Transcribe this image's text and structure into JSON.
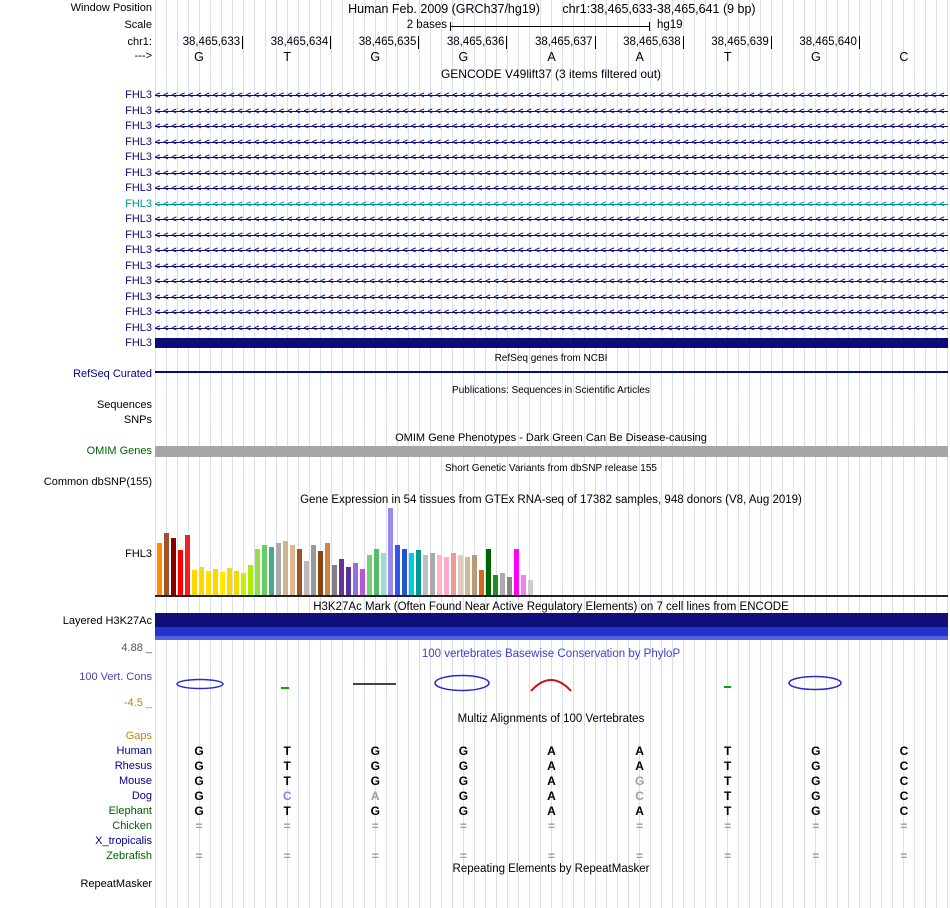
{
  "colors": {
    "grid": "#d3e1f2",
    "gene_blue": "#0c0c78",
    "gene_teal": "#009595",
    "navy": "#00008b",
    "omim_green": "#006400",
    "omim_bar_gray": "#a6a6a6",
    "phylop_title_blue": "#4040d0",
    "gaps_orange": "#c88500",
    "letter_black": "#000000",
    "letter_gray": "#9e9e9e",
    "letter_lightblue": "#8282f0"
  },
  "header": {
    "window_position_label": "Window Position",
    "assembly": "Human Feb. 2009 (GRCh37/hg19)",
    "position": "chr1:38,465,633-38,465,641 (9 bp)",
    "scale_label": "Scale",
    "scale_value": "2 bases",
    "scale_tag": "hg19",
    "chrom_label": "chr1:",
    "strand_label": "--->",
    "coordinates": [
      "38,465,633",
      "38,465,634",
      "38,465,635",
      "38,465,636",
      "38,465,637",
      "38,465,638",
      "38,465,639",
      "38,465,640"
    ],
    "bases": [
      "G",
      "T",
      "G",
      "G",
      "A",
      "A",
      "T",
      "G",
      "C"
    ]
  },
  "gencode": {
    "title": "GENCODE V49lift37 (3 items filtered out)",
    "rows": [
      {
        "label": "FHL3",
        "style": "arrow",
        "color": "blue"
      },
      {
        "label": "FHL3",
        "style": "arrow",
        "color": "blue"
      },
      {
        "label": "FHL3",
        "style": "arrow",
        "color": "blue"
      },
      {
        "label": "FHL3",
        "style": "arrow",
        "color": "blue"
      },
      {
        "label": "FHL3",
        "style": "arrow",
        "color": "blue"
      },
      {
        "label": "FHL3",
        "style": "arrow",
        "color": "blue"
      },
      {
        "label": "FHL3",
        "style": "arrow",
        "color": "blue"
      },
      {
        "label": "FHL3",
        "style": "arrow",
        "color": "teal"
      },
      {
        "label": "FHL3",
        "style": "arrow",
        "color": "blue"
      },
      {
        "label": "FHL3",
        "style": "arrow",
        "color": "blue"
      },
      {
        "label": "FHL3",
        "style": "arrow",
        "color": "blue"
      },
      {
        "label": "FHL3",
        "style": "arrow",
        "color": "blue"
      },
      {
        "label": "FHL3",
        "style": "arrow",
        "color": "blue"
      },
      {
        "label": "FHL3",
        "style": "arrow",
        "color": "blue"
      },
      {
        "label": "FHL3",
        "style": "arrow",
        "color": "blue"
      },
      {
        "label": "FHL3",
        "style": "arrow",
        "color": "blue"
      },
      {
        "label": "FHL3",
        "style": "bar",
        "color": "blue"
      }
    ]
  },
  "refseq": {
    "title": "RefSeq genes from NCBI",
    "label": "RefSeq Curated"
  },
  "publications": {
    "title": "Publications: Sequences in Scientific Articles",
    "sequences_label": "Sequences",
    "snps_label": "SNPs"
  },
  "omim": {
    "title": "OMIM Gene Phenotypes - Dark Green Can Be Disease-causing",
    "label": "OMIM Genes"
  },
  "dbsnp": {
    "title": "Short Genetic Variants from dbSNP release 155",
    "label": "Common dbSNP(155)"
  },
  "gtex": {
    "title": "Gene Expression in 54 tissues from GTEx RNA-seq of 17382 samples, 948 donors (V8, Aug 2019)",
    "label": "FHL3"
  },
  "h3k27ac": {
    "title": "H3K27Ac Mark (Often Found Near Active Regulatory Elements) on 7 cell lines from ENCODE",
    "label": "Layered H3K27Ac"
  },
  "phylop": {
    "title": "100 vertebrates Basewise Conservation by PhyloP",
    "label": "100 Vert. Cons",
    "max_label": "4.88 _",
    "min_label": "-4.5 _"
  },
  "multiz": {
    "title": "Multiz Alignments of 100 Vertebrates",
    "rows": [
      {
        "label": "Gaps",
        "label_color": "#c88500",
        "cells": [
          null,
          null,
          null,
          null,
          null,
          null,
          null,
          null,
          null
        ]
      },
      {
        "label": "Human",
        "label_color": "#00008b",
        "cells": [
          [
            "G",
            "k"
          ],
          [
            "T",
            "k"
          ],
          [
            "G",
            "k"
          ],
          [
            "G",
            "k"
          ],
          [
            "A",
            "k"
          ],
          [
            "A",
            "k"
          ],
          [
            "T",
            "k"
          ],
          [
            "G",
            "k"
          ],
          [
            "C",
            "k"
          ]
        ]
      },
      {
        "label": "Rhesus",
        "label_color": "#00008b",
        "cells": [
          [
            "G",
            "k"
          ],
          [
            "T",
            "k"
          ],
          [
            "G",
            "k"
          ],
          [
            "G",
            "k"
          ],
          [
            "A",
            "k"
          ],
          [
            "A",
            "k"
          ],
          [
            "T",
            "k"
          ],
          [
            "G",
            "k"
          ],
          [
            "C",
            "k"
          ]
        ]
      },
      {
        "label": "Mouse",
        "label_color": "#00008b",
        "cells": [
          [
            "G",
            "k"
          ],
          [
            "T",
            "k"
          ],
          [
            "G",
            "k"
          ],
          [
            "G",
            "k"
          ],
          [
            "A",
            "k"
          ],
          [
            "G",
            "g"
          ],
          [
            "T",
            "k"
          ],
          [
            "G",
            "k"
          ],
          [
            "C",
            "k"
          ]
        ]
      },
      {
        "label": "Dog",
        "label_color": "#00008b",
        "cells": [
          [
            "G",
            "k"
          ],
          [
            "C",
            "b"
          ],
          [
            "A",
            "g"
          ],
          [
            "G",
            "k"
          ],
          [
            "A",
            "k"
          ],
          [
            "C",
            "g"
          ],
          [
            "T",
            "k"
          ],
          [
            "G",
            "k"
          ],
          [
            "C",
            "k"
          ]
        ]
      },
      {
        "label": "Elephant",
        "label_color": "#006400",
        "cells": [
          [
            "G",
            "k"
          ],
          [
            "T",
            "k"
          ],
          [
            "G",
            "k"
          ],
          [
            "G",
            "k"
          ],
          [
            "A",
            "k"
          ],
          [
            "A",
            "k"
          ],
          [
            "T",
            "k"
          ],
          [
            "G",
            "k"
          ],
          [
            "C",
            "k"
          ]
        ]
      },
      {
        "label": "Chicken",
        "label_color": "#006400",
        "cells": [
          [
            "=",
            "g"
          ],
          [
            "=",
            "g"
          ],
          [
            "=",
            "g"
          ],
          [
            "=",
            "g"
          ],
          [
            "=",
            "g"
          ],
          [
            "=",
            "g"
          ],
          [
            "=",
            "g"
          ],
          [
            "=",
            "g"
          ],
          [
            "=",
            "g"
          ]
        ]
      },
      {
        "label": "X_tropicalis",
        "label_color": "#00008b",
        "cells": [
          null,
          null,
          null,
          null,
          null,
          null,
          null,
          null,
          null
        ]
      },
      {
        "label": "Zebrafish",
        "label_color": "#006400",
        "cells": [
          [
            "=",
            "g"
          ],
          [
            "=",
            "g"
          ],
          [
            "=",
            "g"
          ],
          [
            "=",
            "g"
          ],
          [
            "=",
            "g"
          ],
          [
            "=",
            "g"
          ],
          [
            "=",
            "g"
          ],
          [
            "=",
            "g"
          ],
          [
            "=",
            "g"
          ]
        ]
      }
    ]
  },
  "repeatmasker": {
    "title": "Repeating Elements by RepeatMasker",
    "label": "RepeatMasker"
  },
  "chart_data": [
    {
      "type": "bar",
      "title": "Gene Expression in 54 tissues from GTEx RNA-seq of 17382 samples, 948 donors (V8, Aug 2019)",
      "gene": "FHL3",
      "note": "54 GTEx tissue bars; tissue names not visible in screenshot; values are approximate bar heights in pixels",
      "values": [
        52,
        62,
        57,
        45,
        60,
        25,
        28,
        24,
        26,
        23,
        27,
        24,
        22,
        30,
        46,
        50,
        48,
        52,
        54,
        50,
        46,
        34,
        50,
        44,
        52,
        30,
        36,
        28,
        32,
        26,
        40,
        46,
        42,
        87,
        50,
        46,
        42,
        45,
        40,
        42,
        40,
        38,
        42,
        40,
        38,
        40,
        25,
        46,
        20,
        22,
        18,
        46,
        20,
        15
      ],
      "colors": [
        "#ff8c00",
        "#a0522d",
        "#8b0000",
        "#ff0000",
        "#ee2222",
        "#ffd700",
        "#ffd700",
        "#ffe000",
        "#ffd700",
        "#ffea00",
        "#ffd700",
        "#eedd00",
        "#ccee00",
        "#aaee00",
        "#99dd44",
        "#66cc66",
        "#44aa88",
        "#aaaaaa",
        "#d2b48c",
        "#deb887",
        "#a0522d",
        "#bbbbbb",
        "#999999",
        "#8b4513",
        "#cd853f",
        "#808080",
        "#663399",
        "#553399",
        "#9370db",
        "#ba55d3",
        "#77cc77",
        "#55bb66",
        "#99ddcc",
        "#9988ee",
        "#3355ee",
        "#2255cc",
        "#00ced1",
        "#009999",
        "#c0c0c0",
        "#aaaaaa",
        "#ffb6c1",
        "#ffaacc",
        "#ee9999",
        "#ddccbb",
        "#ccbb99",
        "#bb9977",
        "#d2691e",
        "#006400",
        "#228b22",
        "#aaaaaa",
        "#888888",
        "#ff00ff",
        "#ee82ee",
        "#cccccc"
      ]
    },
    {
      "type": "line",
      "title": "100 vertebrates Basewise Conservation by PhyloP",
      "ylim": [
        -4.5,
        4.88
      ],
      "note": "per-base conservation glyphs (blue ellipses, red peak at base 5, small green marks); exact values not labeled in screenshot"
    }
  ]
}
